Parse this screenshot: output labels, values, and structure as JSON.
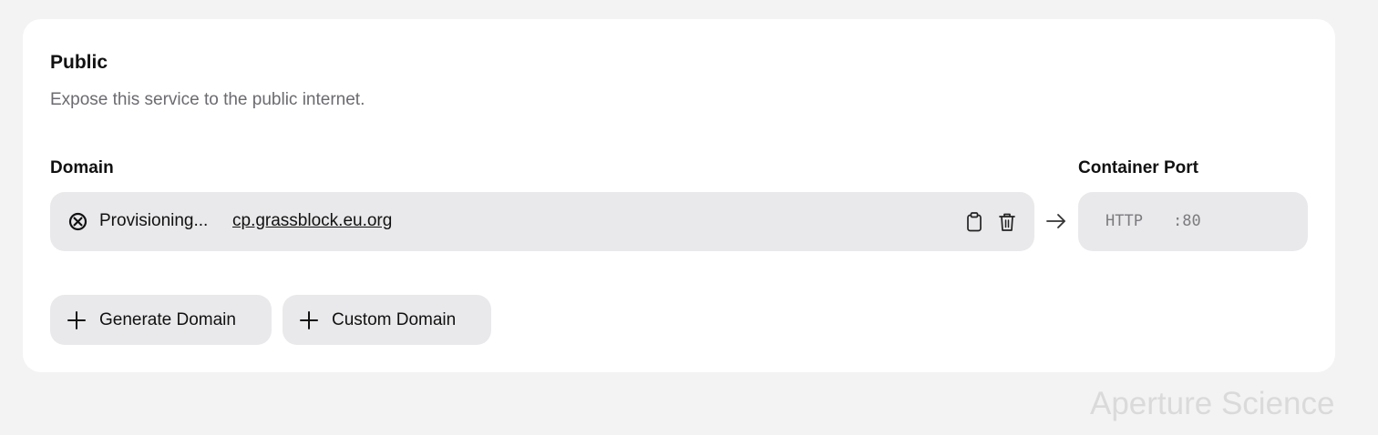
{
  "section": {
    "title": "Public",
    "subtitle": "Expose this service to the public internet."
  },
  "domain": {
    "label": "Domain",
    "status_icon": "circle-x-icon",
    "status": "Provisioning...",
    "value": "cp.grassblock.eu.org",
    "actions": [
      "clipboard-icon",
      "trash-icon"
    ]
  },
  "arrow_icon": "arrow-right-icon",
  "container_port": {
    "label": "Container Port",
    "protocol": "HTTP",
    "port": ":80"
  },
  "buttons": {
    "generate_domain": "Generate Domain",
    "custom_domain": "Custom Domain"
  },
  "watermark": "Aperture Science",
  "colors": {
    "background": "#f3f3f3",
    "card": "#ffffff",
    "field": "#e9e9eb",
    "muted_text": "#6b6b70"
  }
}
